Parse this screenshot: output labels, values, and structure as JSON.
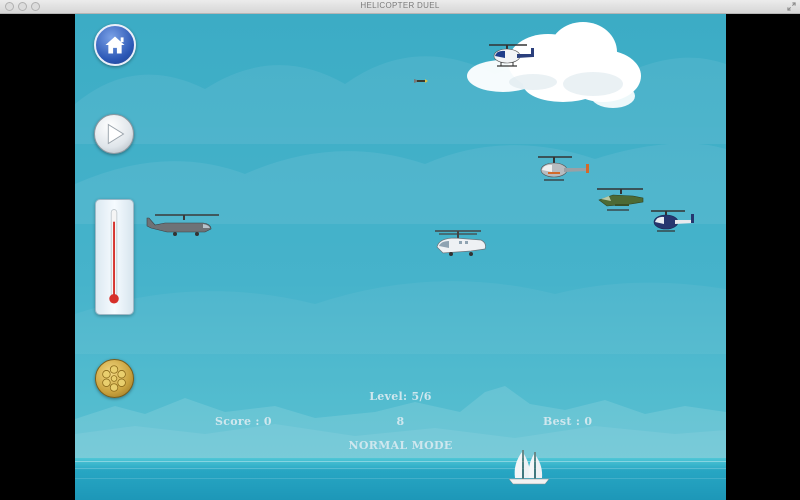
{
  "window": {
    "title": "HELICOPTER DUEL"
  },
  "hud": {
    "level": "Level: 5/6",
    "score": "Score : 0",
    "count": "8",
    "best": "Best : 0",
    "mode": "NORMAL MODE"
  },
  "controls": {
    "home_icon": "home-icon",
    "play_icon": "play-icon",
    "gauge_icon": "thermometer-icon",
    "gear_icon": "bullet-cylinder-icon",
    "heat_level": 0.9
  },
  "colors": {
    "sky": "#46b3cb",
    "sea": "#1d97b8",
    "home_blue": "#2b57b5",
    "gauge_red": "#d6302a",
    "gold": "#c9a23e"
  }
}
